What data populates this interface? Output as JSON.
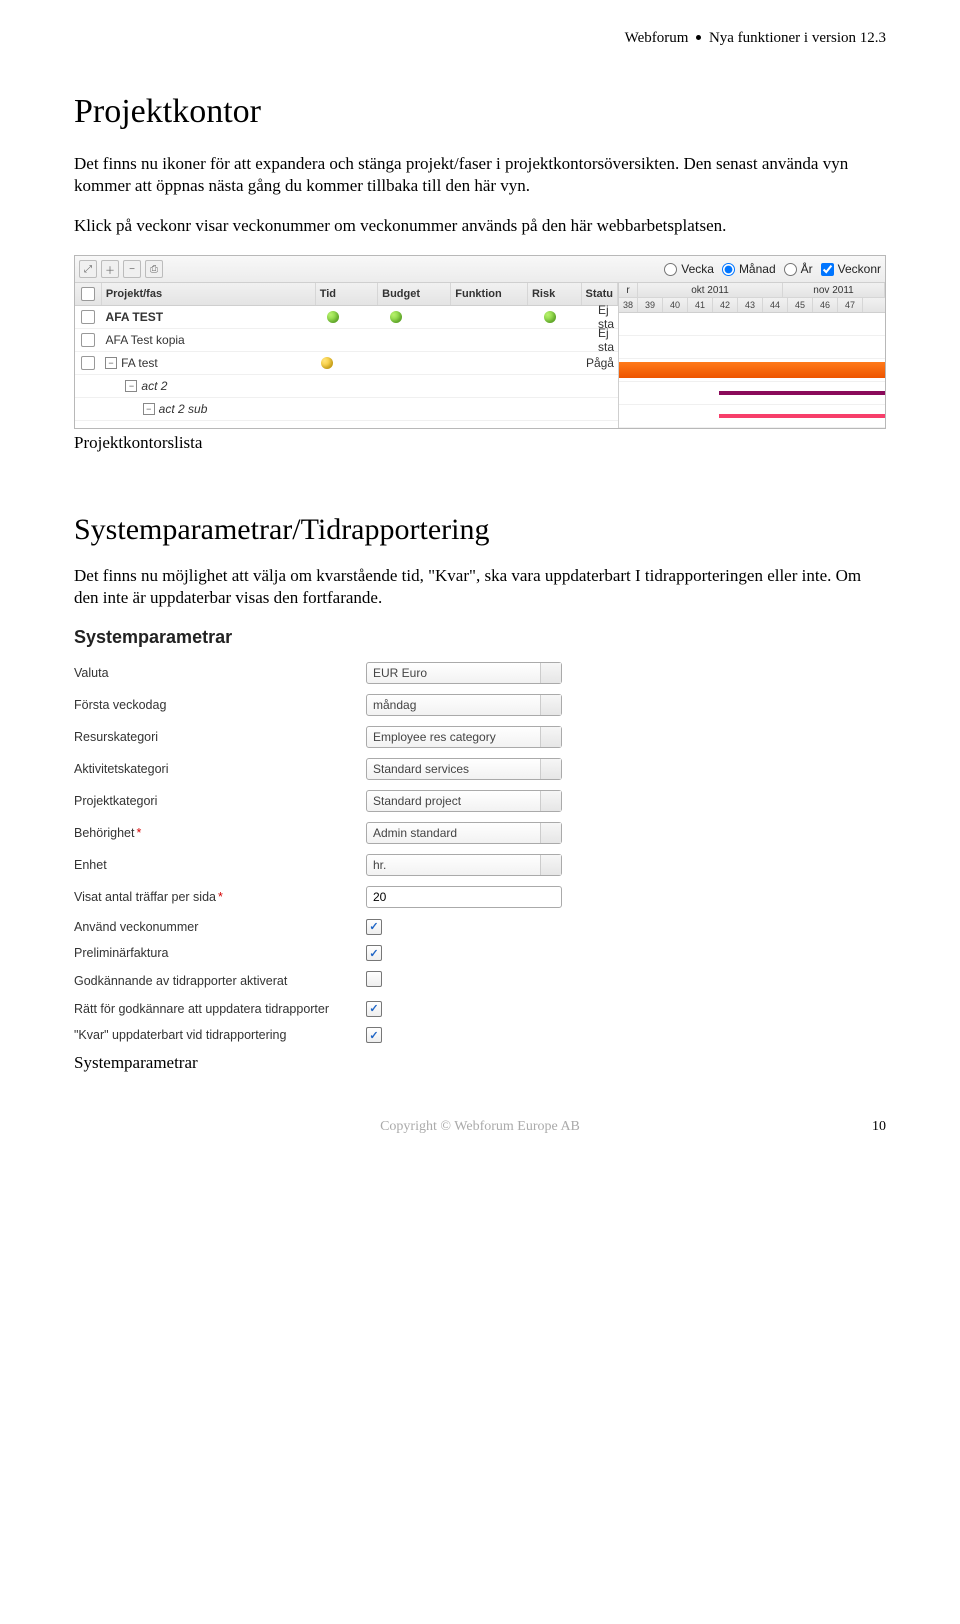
{
  "header": {
    "prefix": "Webforum",
    "suffix": "Nya funktioner i version 12.3"
  },
  "section1": {
    "title": "Projektkontor",
    "p1": "Det finns nu ikoner för att expandera och stänga projekt/faser i projektkontorsöversikten. Den senast använda vyn kommer att öppnas nästa gång du kommer tillbaka till den här vyn.",
    "p2": "Klick på veckonr visar veckonummer om veckonummer används på den här webbarbetsplatsen.",
    "caption": "Projektkontorslista"
  },
  "shot1": {
    "toolbar": {
      "radios": {
        "vecka": "Vecka",
        "manad": "Månad",
        "ar": "År"
      },
      "veckonr": "Veckonr"
    },
    "columns": {
      "col0": "Projekt/fas",
      "col1": "Tid",
      "col2": "Budget",
      "col3": "Funktion",
      "col4": "Risk",
      "col5": "Statu"
    },
    "months": {
      "before": "r",
      "okt": "okt 2011",
      "nov": "nov 2011"
    },
    "weeks": [
      "38",
      "39",
      "40",
      "41",
      "42",
      "43",
      "44",
      "45",
      "46",
      "47"
    ],
    "rows": [
      {
        "name": "AFA TEST",
        "tid": "green",
        "budget": "green",
        "funktion": "",
        "risk": "green",
        "status": "Ej sta"
      },
      {
        "name": "AFA Test kopia",
        "tid": "",
        "budget": "",
        "funktion": "",
        "risk": "",
        "status": "Ej sta"
      },
      {
        "name": "FA test",
        "tid": "yellow",
        "budget": "",
        "funktion": "",
        "risk": "",
        "status": "Pågå"
      },
      {
        "name": "act 2",
        "tid": "",
        "budget": "",
        "funktion": "",
        "risk": "",
        "status": ""
      },
      {
        "name": "act 2 sub",
        "tid": "",
        "budget": "",
        "funktion": "",
        "risk": "",
        "status": ""
      }
    ]
  },
  "section2": {
    "title": "Systemparametrar/Tidrapportering",
    "p1": "Det finns nu möjlighet att välja om kvarstående tid, \"Kvar\", ska vara uppdaterbart I tidrapporteringen eller inte. Om den inte är uppdaterbar visas den fortfarande.",
    "formtitle": "Systemparametrar",
    "caption": "Systemparametrar"
  },
  "form": {
    "valuta": {
      "label": "Valuta",
      "value": "EUR Euro"
    },
    "veckodag": {
      "label": "Första veckodag",
      "value": "måndag"
    },
    "resurs": {
      "label": "Resurskategori",
      "value": "Employee res category"
    },
    "aktivitet": {
      "label": "Aktivitetskategori",
      "value": "Standard services"
    },
    "projekt": {
      "label": "Projektkategori",
      "value": "Standard project"
    },
    "behorighet": {
      "label": "Behörighet",
      "value": "Admin standard",
      "required": "*"
    },
    "enhet": {
      "label": "Enhet",
      "value": "hr."
    },
    "traffar": {
      "label": "Visat antal träffar per sida",
      "value": "20",
      "required": "*"
    },
    "veckonr": {
      "label": "Använd veckonummer"
    },
    "prelim": {
      "label": "Preliminärfaktura"
    },
    "godk": {
      "label": "Godkännande av tidrapporter aktiverat"
    },
    "ratt": {
      "label": "Rätt för godkännare att uppdatera tidrapporter"
    },
    "kvar": {
      "label": "\"Kvar\" uppdaterbart vid tidrapportering"
    }
  },
  "footer": {
    "center_prefix": "Copyright",
    "center_suffix": "Webforum Europe AB",
    "pagenum": "10"
  }
}
